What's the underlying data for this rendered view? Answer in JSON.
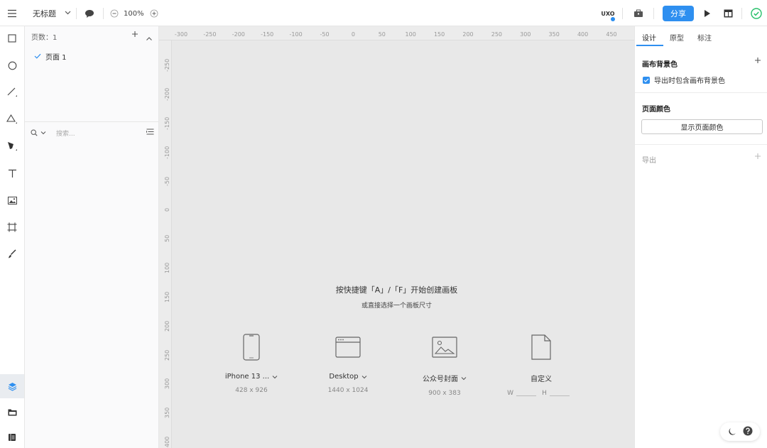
{
  "header": {
    "title": "无标题",
    "zoom": "100%",
    "uxo_label": "UXO",
    "share_label": "分享"
  },
  "pages_panel": {
    "count_label": "页数：1",
    "pages": [
      {
        "name": "页面 1",
        "selected": true
      }
    ],
    "search_placeholder": "搜索..."
  },
  "canvas": {
    "ruler_top": [
      "-300",
      "-250",
      "-200",
      "-150",
      "-100",
      "-50",
      "0",
      "50",
      "100",
      "150",
      "200",
      "250",
      "300",
      "350",
      "400",
      "450"
    ],
    "ruler_left": [
      "-250",
      "-200",
      "-150",
      "-100",
      "-50",
      "0",
      "50",
      "100",
      "150",
      "200",
      "250",
      "300",
      "350",
      "400"
    ],
    "hint_main": "按快捷键「A」/「F」开始创建画板",
    "hint_sub": "或直接选择一个画板尺寸",
    "presets": [
      {
        "label": "iPhone 13 ...",
        "size": "428 x 926",
        "icon": "phone-icon"
      },
      {
        "label": "Desktop",
        "size": "1440 x 1024",
        "icon": "browser-window-icon"
      },
      {
        "label": "公众号封面",
        "size": "900 x 383",
        "icon": "image-icon"
      },
      {
        "label": "自定义",
        "icon": "document-icon",
        "w_label": "W",
        "h_label": "H"
      }
    ]
  },
  "right_panel": {
    "tabs": [
      "设计",
      "原型",
      "标注"
    ],
    "active_tab": "设计",
    "canvas_bg_title": "画布背景色",
    "export_bg_label": "导出时包含画布背景色",
    "export_bg_checked": true,
    "page_color_title": "页面颜色",
    "show_page_color_button": "显示页面颜色",
    "export_title": "导出"
  },
  "colors": {
    "accent": "#2e8ff0",
    "canvas_bg": "#e8e8e8",
    "success": "#27c06a"
  }
}
